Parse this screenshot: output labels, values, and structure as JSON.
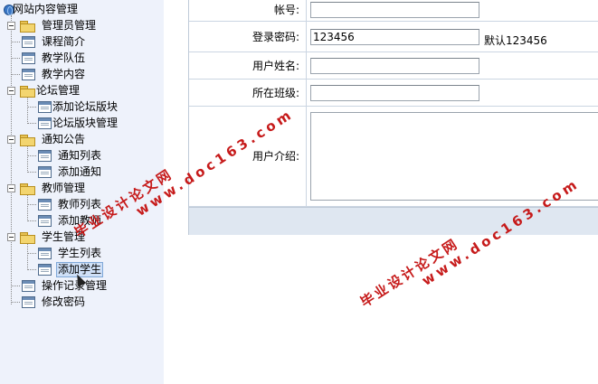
{
  "sidebar": {
    "root": "网站内容管理",
    "items": [
      {
        "label": "管理员管理"
      },
      {
        "label": "课程简介"
      },
      {
        "label": "教学队伍"
      },
      {
        "label": "教学内容"
      },
      {
        "label": "论坛管理",
        "children": [
          {
            "label": "添加论坛版块"
          },
          {
            "label": "论坛版块管理"
          }
        ]
      },
      {
        "label": "通知公告",
        "children": [
          {
            "label": "通知列表"
          },
          {
            "label": "添加通知"
          }
        ]
      },
      {
        "label": "教师管理",
        "children": [
          {
            "label": "教师列表"
          },
          {
            "label": "添加教师"
          }
        ]
      },
      {
        "label": "学生管理",
        "children": [
          {
            "label": "学生列表"
          },
          {
            "label": "添加学生"
          }
        ]
      },
      {
        "label": "操作记录管理"
      },
      {
        "label": "修改密码"
      }
    ],
    "selected": "添加学生"
  },
  "form": {
    "account_label": "帐号:",
    "account_value": "",
    "password_label": "登录密码:",
    "password_value": "123456",
    "password_hint": "默认123456",
    "name_label": "用户姓名:",
    "name_value": "",
    "class_label": "所在班级:",
    "class_value": "",
    "intro_label": "用户介绍:",
    "intro_value": ""
  },
  "watermarks": [
    {
      "line1": "毕业设计论文网",
      "line2": "www.doc163.com"
    },
    {
      "line1": "毕业设计论文网",
      "line2": "www.doc163.com"
    }
  ],
  "colors": {
    "sidebar_bg": "#eef2fb",
    "watermark": "#c61a1a",
    "footer_bar": "#dfe7f1"
  }
}
